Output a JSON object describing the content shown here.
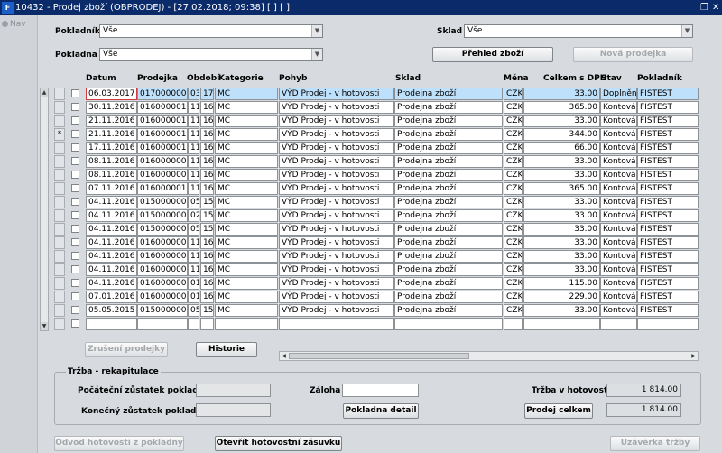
{
  "window": {
    "title": "10432 - Prodej zboží (OBPRODEJ) - [27.02.2018; 09:38]  [ ]  [ ]",
    "restore_icon": "restore-icon",
    "close_icon": "close-icon"
  },
  "nav": {
    "label": "Nav"
  },
  "filters": {
    "pokladnik_label": "Pokladník",
    "pokladnik_value": "Vše",
    "sklad_label": "Sklad",
    "sklad_value": "Vše",
    "pokladna_label": "Pokladna",
    "pokladna_value": "Vše"
  },
  "buttons": {
    "prehled_zbozi": "Přehled zboží",
    "nova_prodejka": "Nová prodejka",
    "zruseni_prodejky": "Zrušení prodejky",
    "historie": "Historie",
    "pokladni_detail": "Pokladna detail",
    "prodej_celkem": "Prodej celkem",
    "odvod_hotovosti": "Odvod hotovosti z pokladny",
    "otevrit_zasuvku": "Otevřít hotovostní zásuvku",
    "uzaverka_trzby": "Uzávěrka tržby"
  },
  "table": {
    "columns": [
      "Datum",
      "Prodejka",
      "Období",
      "Kategorie",
      "Pohyb",
      "Sklad",
      "Měna",
      "Celkem s DPH",
      "Stav",
      "Pokladník"
    ],
    "rows": [
      {
        "datum": "06.03.2017",
        "prodejka": "0170000001",
        "obd1": "03",
        "obd2": "17",
        "kategorie": "MC",
        "pohyb": "VÝD Prodej - v hotovosti",
        "sklad": "Prodejna zboží",
        "mena": "CZK",
        "celkem": "33.00",
        "stav": "Doplněn",
        "pokladnik": "FISTEST",
        "marker": ""
      },
      {
        "datum": "30.11.2016",
        "prodejka": "0160000014",
        "obd1": "11",
        "obd2": "16",
        "kategorie": "MC",
        "pohyb": "VÝD Prodej - v hotovosti",
        "sklad": "Prodejna zboží",
        "mena": "CZK",
        "celkem": "365.00",
        "stav": "Kontován",
        "pokladnik": "FISTEST",
        "marker": ""
      },
      {
        "datum": "21.11.2016",
        "prodejka": "0160000013",
        "obd1": "11",
        "obd2": "16",
        "kategorie": "MC",
        "pohyb": "VÝD Prodej - v hotovosti",
        "sklad": "Prodejna zboží",
        "mena": "CZK",
        "celkem": "33.00",
        "stav": "Kontován",
        "pokladnik": "FISTEST",
        "marker": ""
      },
      {
        "datum": "21.11.2016",
        "prodejka": "0160000016",
        "obd1": "11",
        "obd2": "16",
        "kategorie": "MC",
        "pohyb": "VÝD Prodej - v hotovosti",
        "sklad": "Prodejna zboží",
        "mena": "CZK",
        "celkem": "344.00",
        "stav": "Kontován",
        "pokladnik": "FISTEST",
        "marker": "*"
      },
      {
        "datum": "17.11.2016",
        "prodejka": "0160000015",
        "obd1": "11",
        "obd2": "16",
        "kategorie": "MC",
        "pohyb": "VÝD Prodej - v hotovosti",
        "sklad": "Prodejna zboží",
        "mena": "CZK",
        "celkem": "66.00",
        "stav": "Kontován",
        "pokladnik": "FISTEST",
        "marker": ""
      },
      {
        "datum": "08.11.2016",
        "prodejka": "0160000008",
        "obd1": "11",
        "obd2": "16",
        "kategorie": "MC",
        "pohyb": "VÝD Prodej - v hotovosti",
        "sklad": "Prodejna zboží",
        "mena": "CZK",
        "celkem": "33.00",
        "stav": "Kontován",
        "pokladnik": "FISTEST",
        "marker": ""
      },
      {
        "datum": "08.11.2016",
        "prodejka": "0160000006",
        "obd1": "11",
        "obd2": "16",
        "kategorie": "MC",
        "pohyb": "VÝD Prodej - v hotovosti",
        "sklad": "Prodejna zboží",
        "mena": "CZK",
        "celkem": "33.00",
        "stav": "Kontován",
        "pokladnik": "FISTEST",
        "marker": ""
      },
      {
        "datum": "07.11.2016",
        "prodejka": "0160000012",
        "obd1": "11",
        "obd2": "16",
        "kategorie": "MC",
        "pohyb": "VÝD Prodej - v hotovosti",
        "sklad": "Prodejna zboží",
        "mena": "CZK",
        "celkem": "365.00",
        "stav": "Kontován",
        "pokladnik": "FISTEST",
        "marker": ""
      },
      {
        "datum": "04.11.2016",
        "prodejka": "0150000004",
        "obd1": "05",
        "obd2": "15",
        "kategorie": "MC",
        "pohyb": "VÝD Prodej - v hotovosti",
        "sklad": "Prodejna zboží",
        "mena": "CZK",
        "celkem": "33.00",
        "stav": "Kontován",
        "pokladnik": "FISTEST",
        "marker": ""
      },
      {
        "datum": "04.11.2016",
        "prodejka": "0150000002",
        "obd1": "02",
        "obd2": "15",
        "kategorie": "MC",
        "pohyb": "VÝD Prodej - v hotovosti",
        "sklad": "Prodejna zboží",
        "mena": "CZK",
        "celkem": "33.00",
        "stav": "Kontován",
        "pokladnik": "FISTEST",
        "marker": ""
      },
      {
        "datum": "04.11.2016",
        "prodejka": "0150000005",
        "obd1": "05",
        "obd2": "15",
        "kategorie": "MC",
        "pohyb": "VÝD Prodej - v hotovosti",
        "sklad": "Prodejna zboží",
        "mena": "CZK",
        "celkem": "33.00",
        "stav": "Kontován",
        "pokladnik": "FISTEST",
        "marker": ""
      },
      {
        "datum": "04.11.2016",
        "prodejka": "0160000005",
        "obd1": "11",
        "obd2": "16",
        "kategorie": "MC",
        "pohyb": "VÝD Prodej - v hotovosti",
        "sklad": "Prodejna zboží",
        "mena": "CZK",
        "celkem": "33.00",
        "stav": "Kontován",
        "pokladnik": "FISTEST",
        "marker": ""
      },
      {
        "datum": "04.11.2016",
        "prodejka": "0160000004",
        "obd1": "11",
        "obd2": "16",
        "kategorie": "MC",
        "pohyb": "VÝD Prodej - v hotovosti",
        "sklad": "Prodejna zboží",
        "mena": "CZK",
        "celkem": "33.00",
        "stav": "Kontován",
        "pokladnik": "FISTEST",
        "marker": ""
      },
      {
        "datum": "04.11.2016",
        "prodejka": "0160000003",
        "obd1": "11",
        "obd2": "16",
        "kategorie": "MC",
        "pohyb": "VÝD Prodej - v hotovosti",
        "sklad": "Prodejna zboží",
        "mena": "CZK",
        "celkem": "33.00",
        "stav": "Kontován",
        "pokladnik": "FISTEST",
        "marker": ""
      },
      {
        "datum": "04.11.2016",
        "prodejka": "0160000002",
        "obd1": "01",
        "obd2": "16",
        "kategorie": "MC",
        "pohyb": "VÝD Prodej - v hotovosti",
        "sklad": "Prodejna zboží",
        "mena": "CZK",
        "celkem": "115.00",
        "stav": "Kontován",
        "pokladnik": "FISTEST",
        "marker": ""
      },
      {
        "datum": "07.01.2016",
        "prodejka": "0160000001",
        "obd1": "01",
        "obd2": "16",
        "kategorie": "MC",
        "pohyb": "VÝD Prodej - v hotovosti",
        "sklad": "Prodejna zboží",
        "mena": "CZK",
        "celkem": "229.00",
        "stav": "Kontován",
        "pokladnik": "FISTEST",
        "marker": ""
      },
      {
        "datum": "05.05.2015",
        "prodejka": "0150000003",
        "obd1": "05",
        "obd2": "15",
        "kategorie": "MC",
        "pohyb": "VÝD Prodej - v hotovosti",
        "sklad": "Prodejna zboží",
        "mena": "CZK",
        "celkem": "33.00",
        "stav": "Kontován",
        "pokladnik": "FISTEST",
        "marker": ""
      }
    ]
  },
  "recap": {
    "title": "Tržba - rekapitulace",
    "pocatecni_label": "Počáteční zůstatek pokladny",
    "pocatecni_value": "",
    "konecny_label": "Konečný zůstatek pokladny",
    "konecny_value": "",
    "zaloha_label": "Záloha",
    "zaloha_value": "",
    "trzba_label": "Tržba v hotovosti",
    "trzba_value": "1 814.00",
    "prodej_celkem_value": "1 814.00"
  }
}
